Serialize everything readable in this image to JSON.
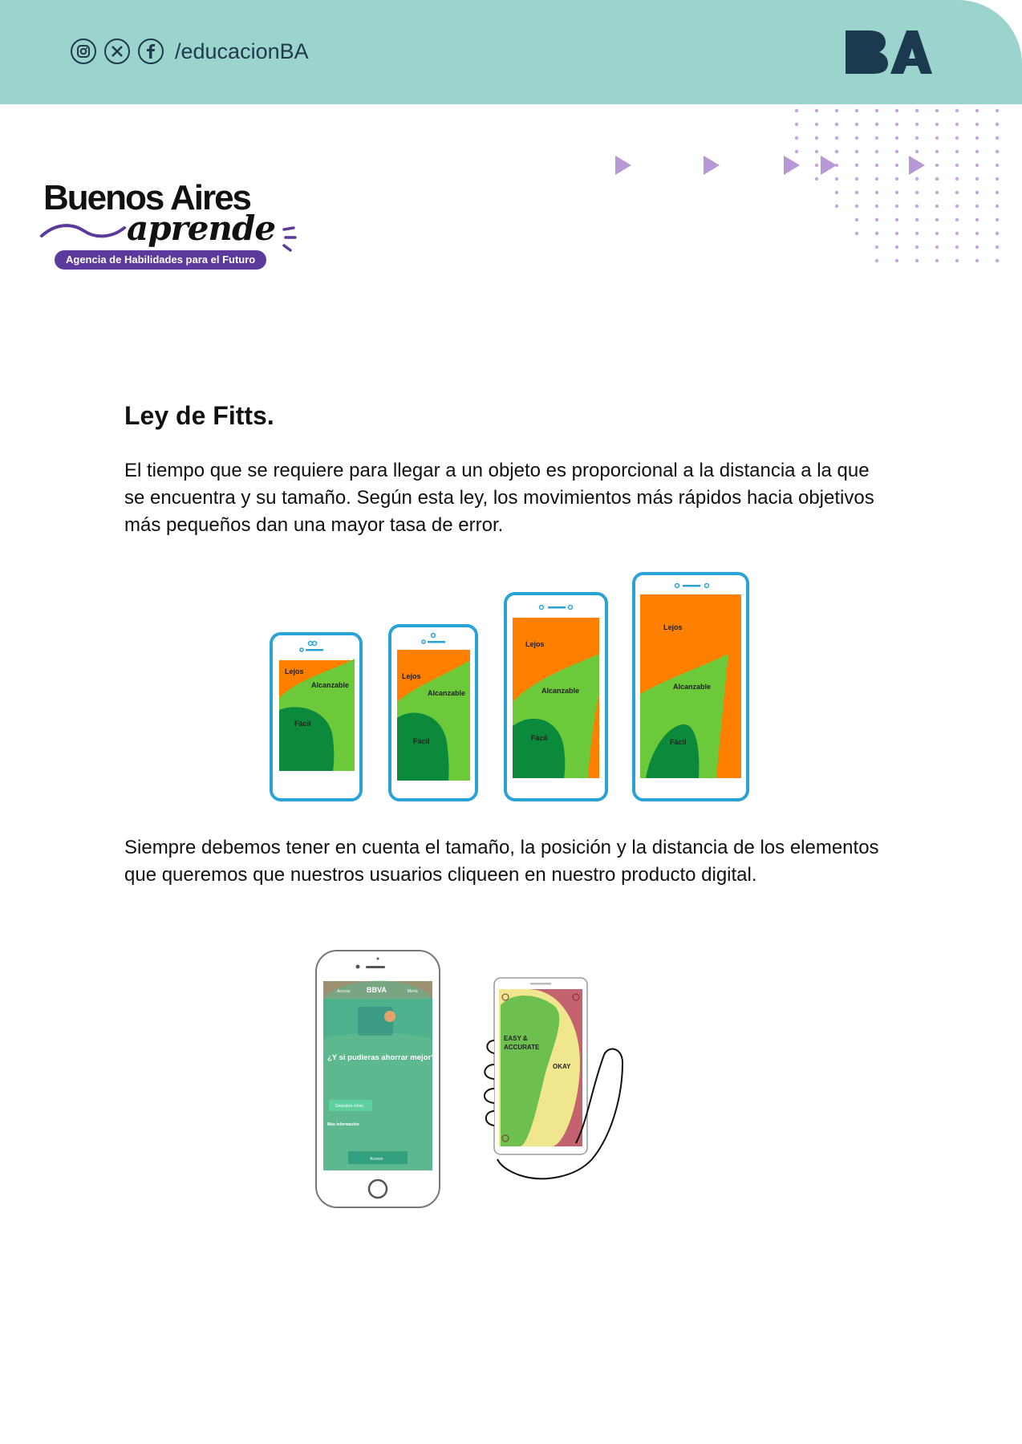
{
  "header": {
    "social_handle": "/educacionBA",
    "social_icons": [
      "instagram-icon",
      "x-icon",
      "facebook-icon"
    ],
    "logo_text": "BA",
    "band_color": "#9bd3cd"
  },
  "brand": {
    "title": "Buenos Aires",
    "script": "aprende",
    "tagline": "Agencia de Habilidades para el Futuro",
    "pill_color": "#5b3a9c"
  },
  "content": {
    "title": "Ley de Fitts.",
    "paragraph1": "El tiempo que se requiere para llegar a un objeto es proporcional a la distancia a la que se encuentra y su tamaño. Según esta ley, los movimientos más rápidos hacia objetivos más pequeños dan una mayor tasa de error.",
    "paragraph2": "Siempre debemos tener en cuenta el tamaño, la posición y la distancia de los elementos que queremos que nuestros usuarios cliqueen en nuestro producto digital."
  },
  "figure1": {
    "zone_far": "Lejos",
    "zone_reachable": "Alcanzable",
    "zone_easy": "Fácil",
    "colors": {
      "far": "#ff7f00",
      "reachable": "#6cc93a",
      "easy": "#0c8a3c",
      "frame": "#29a3d6"
    }
  },
  "figure2": {
    "bank_name": "BBVA",
    "top_left_label": "Acceso",
    "top_right_label": "Menú",
    "headline": "¿Y si pudieras ahorrar mejor?",
    "cta_label": "Descubre cómo",
    "more_info": "Más información",
    "bottom_button": "Acceso",
    "zone_easy": "EASY &",
    "zone_accurate": "ACCURATE",
    "zone_okay": "OKAY",
    "colors": {
      "easy": "#6dbf4f",
      "okay": "#efe68d",
      "hard": "#c4626f",
      "teal": "#3aa98c"
    }
  }
}
